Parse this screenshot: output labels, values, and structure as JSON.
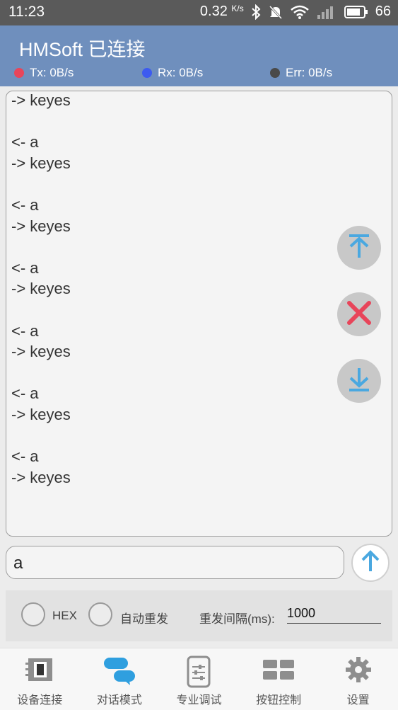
{
  "status_bar": {
    "time": "11:23",
    "speed": "0.32",
    "speed_unit": "K/s",
    "battery": "66"
  },
  "app": {
    "title": "HMSoft 已连接"
  },
  "stats": [
    {
      "label": "Tx: 0B/s",
      "color": "#e8455a"
    },
    {
      "label": "Rx: 0B/s",
      "color": "#3d5bf0"
    },
    {
      "label": "Err: 0B/s",
      "color": "#4a4a4a"
    }
  ],
  "log": {
    "lines": [
      "-> keyes",
      "",
      "<- a",
      "-> keyes",
      "",
      "<- a",
      "-> keyes",
      "",
      "<- a",
      "-> keyes",
      "",
      "<- a",
      "-> keyes",
      "",
      "<- a",
      "-> keyes",
      "",
      "<- a",
      "-> keyes"
    ]
  },
  "input": {
    "value": "a"
  },
  "options": {
    "hex_label": "HEX",
    "auto_resend_label": "自动重发",
    "interval_label": "重发间隔(ms):",
    "interval_value": "1000"
  },
  "nav": [
    {
      "label": "设备连接",
      "icon": "device-connect-icon"
    },
    {
      "label": "对话模式",
      "icon": "chat-mode-icon"
    },
    {
      "label": "专业调试",
      "icon": "pro-debug-icon"
    },
    {
      "label": "按钮控制",
      "icon": "button-control-icon"
    },
    {
      "label": "设置",
      "icon": "settings-icon"
    }
  ],
  "colors": {
    "accent": "#4aa8e0",
    "appbar": "#6f8fbd",
    "clear": "#e8455a"
  }
}
